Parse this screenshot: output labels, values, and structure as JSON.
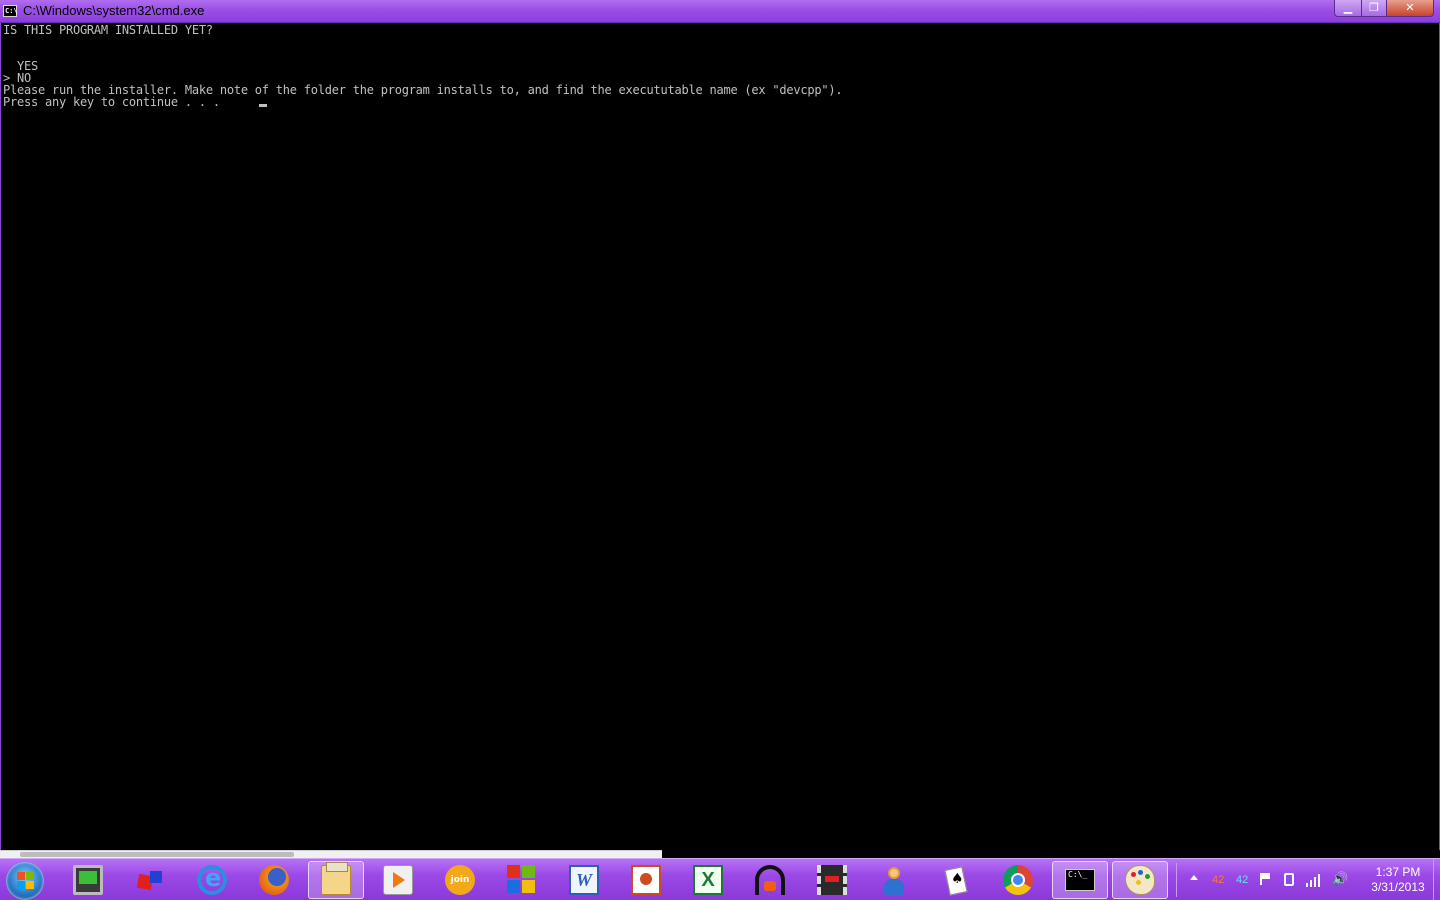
{
  "window": {
    "title": "C:\\Windows\\system32\\cmd.exe",
    "icon_text": "C:\\",
    "icon": "cmd-icon",
    "controls": {
      "minimize": "minimize-icon",
      "maximize": "restore-icon",
      "close": "close-icon"
    },
    "minimize_glyph": "▁",
    "maximize_glyph": "❐",
    "close_glyph": "✕"
  },
  "console": {
    "lines": [
      "IS THIS PROGRAM INSTALLED YET?",
      "",
      "",
      "  YES",
      "> NO",
      "Please run the installer. Make note of the folder the program installs to, and find the execututable name (ex \"devcpp\").",
      "Press any key to continue . . . "
    ],
    "colors": {
      "background": "#000000",
      "text": "#c0c0c0"
    }
  },
  "taskbar": {
    "accent": "#9a48e6",
    "start": {
      "icon": "windows-start-icon"
    },
    "items": [
      {
        "name": "computer-icon",
        "open": false
      },
      {
        "name": "games-icon",
        "open": false
      },
      {
        "name": "internet-explorer-icon",
        "open": false
      },
      {
        "name": "firefox-icon",
        "open": false
      },
      {
        "name": "windows-explorer-icon",
        "open": true
      },
      {
        "name": "media-player-icon",
        "open": false
      },
      {
        "name": "joinme-icon",
        "label": "join me",
        "open": false
      },
      {
        "name": "office-icon",
        "open": false
      },
      {
        "name": "word-icon",
        "label": "W",
        "open": false
      },
      {
        "name": "powerpoint-icon",
        "open": false
      },
      {
        "name": "excel-icon",
        "label": "X",
        "open": false
      },
      {
        "name": "headphones-icon",
        "open": false
      },
      {
        "name": "movie-maker-icon",
        "open": false
      },
      {
        "name": "user-icon",
        "open": false
      },
      {
        "name": "solitaire-icon",
        "open": false
      },
      {
        "name": "chrome-icon",
        "open": false
      },
      {
        "name": "cmd-icon",
        "label": "C:\\_",
        "open": true
      },
      {
        "name": "paint-icon",
        "open": true
      }
    ],
    "tray": {
      "temp1": "42",
      "temp2": "42",
      "temp1_color": "#ff7a30",
      "temp2_color": "#66e0ff",
      "time": "1:37 PM",
      "date": "3/31/2013"
    }
  }
}
